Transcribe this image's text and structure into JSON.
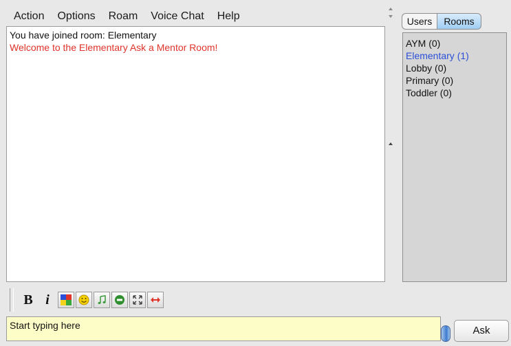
{
  "menu": [
    "Action",
    "Options",
    "Roam",
    "Voice Chat",
    "Help"
  ],
  "chat": {
    "messages": [
      {
        "text": "You have joined room: Elementary",
        "style": "system"
      },
      {
        "text": "Welcome to the Elementary Ask a Mentor Room!",
        "style": "welcome"
      }
    ]
  },
  "tabs": {
    "users": "Users",
    "rooms": "Rooms",
    "selected": "Rooms"
  },
  "rooms": [
    {
      "label": "AYM (0)"
    },
    {
      "label": "Elementary (1)",
      "active": true
    },
    {
      "label": "Lobby (0)"
    },
    {
      "label": "Primary (0)"
    },
    {
      "label": "Toddler (0)"
    }
  ],
  "toolbar": {
    "bold": "B",
    "italic": "i"
  },
  "input": {
    "placeholder": "Start typing here"
  },
  "ask_button": "Ask",
  "colors": {
    "welcome": "#e0332a",
    "active_room": "#2b4fd8",
    "input_bg": "#fdfdc8"
  }
}
